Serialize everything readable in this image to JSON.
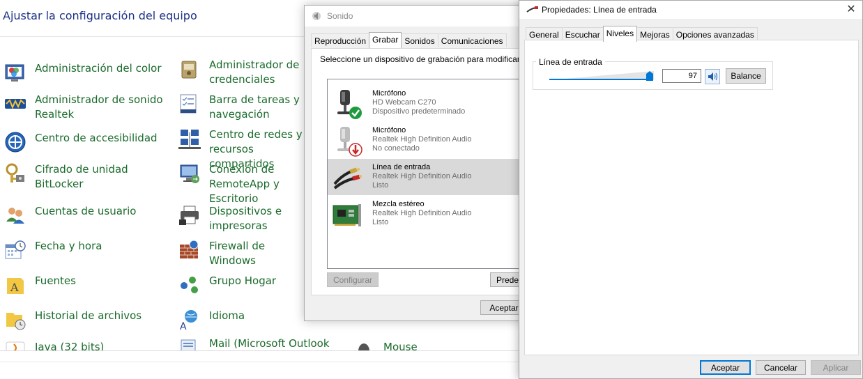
{
  "control_panel": {
    "title": "Ajustar la configuración del equipo",
    "col1": [
      {
        "label": "Administración del color",
        "icon": "color-management-icon"
      },
      {
        "label": "Administrador de sonido Realtek",
        "icon": "realtek-sound-icon"
      },
      {
        "label": "Centro de accesibilidad",
        "icon": "accessibility-icon"
      },
      {
        "label": "Cifrado de unidad BitLocker",
        "icon": "bitlocker-icon"
      },
      {
        "label": "Cuentas de usuario",
        "icon": "user-accounts-icon"
      },
      {
        "label": "Fecha y hora",
        "icon": "date-time-icon"
      },
      {
        "label": "Fuentes",
        "icon": "fonts-icon"
      },
      {
        "label": "Historial de archivos",
        "icon": "file-history-icon"
      },
      {
        "label": "Java (32 bits)",
        "icon": "java-icon"
      }
    ],
    "col2": [
      {
        "label": "Administrador de credenciales",
        "icon": "credential-manager-icon"
      },
      {
        "label": "Barra de tareas y navegación",
        "icon": "taskbar-icon"
      },
      {
        "label": "Centro de redes y recursos compartidos",
        "icon": "network-center-icon"
      },
      {
        "label": "Conexión de RemoteApp y Escritorio",
        "icon": "remote-desktop-icon"
      },
      {
        "label": "Dispositivos e impresoras",
        "icon": "devices-printers-icon"
      },
      {
        "label": "Firewall de Windows",
        "icon": "firewall-icon"
      },
      {
        "label": "Grupo Hogar",
        "icon": "homegroup-icon"
      },
      {
        "label": "Idioma",
        "icon": "language-icon"
      },
      {
        "label": "Mail (Microsoft Outlook",
        "icon": "mail-icon"
      }
    ],
    "col3_partial": "Mouse"
  },
  "sonido": {
    "title": "Sonido",
    "tabs": [
      "Reproducción",
      "Grabar",
      "Sonidos",
      "Comunicaciones"
    ],
    "active_tab": "Grabar",
    "instruction": "Seleccione un dispositivo de grabación para modificar",
    "devices": [
      {
        "name": "Micrófono",
        "sub": "HD Webcam C270",
        "status": "Dispositivo predeterminado",
        "icon": "microphone-default-icon",
        "selected": false
      },
      {
        "name": "Micrófono",
        "sub": "Realtek High Definition Audio",
        "status": "No conectado",
        "icon": "microphone-disconnected-icon",
        "selected": false
      },
      {
        "name": "Línea de entrada",
        "sub": "Realtek High Definition Audio",
        "status": "Listo",
        "icon": "line-in-cable-icon",
        "selected": true
      },
      {
        "name": "Mezcla estéreo",
        "sub": "Realtek High Definition Audio",
        "status": "Listo",
        "icon": "sound-card-icon",
        "selected": false
      }
    ],
    "configure_label": "Configurar",
    "default_label": "Predet",
    "accept_label": "Aceptar"
  },
  "props": {
    "title": "Propiedades: Línea de entrada",
    "close": "✕",
    "tabs": [
      "General",
      "Escuchar",
      "Niveles",
      "Mejoras",
      "Opciones avanzadas"
    ],
    "active_tab": "Niveles",
    "group_label": "Línea de entrada",
    "level_value": "97",
    "level_fraction": 0.97,
    "balance_label": "Balance",
    "accept_label": "Aceptar",
    "cancel_label": "Cancelar",
    "apply_label": "Aplicar"
  },
  "colors": {
    "link_green": "#1a6b2b",
    "title_blue": "#1e3287",
    "accent": "#0078d7",
    "selection": "#d9d9d9"
  }
}
